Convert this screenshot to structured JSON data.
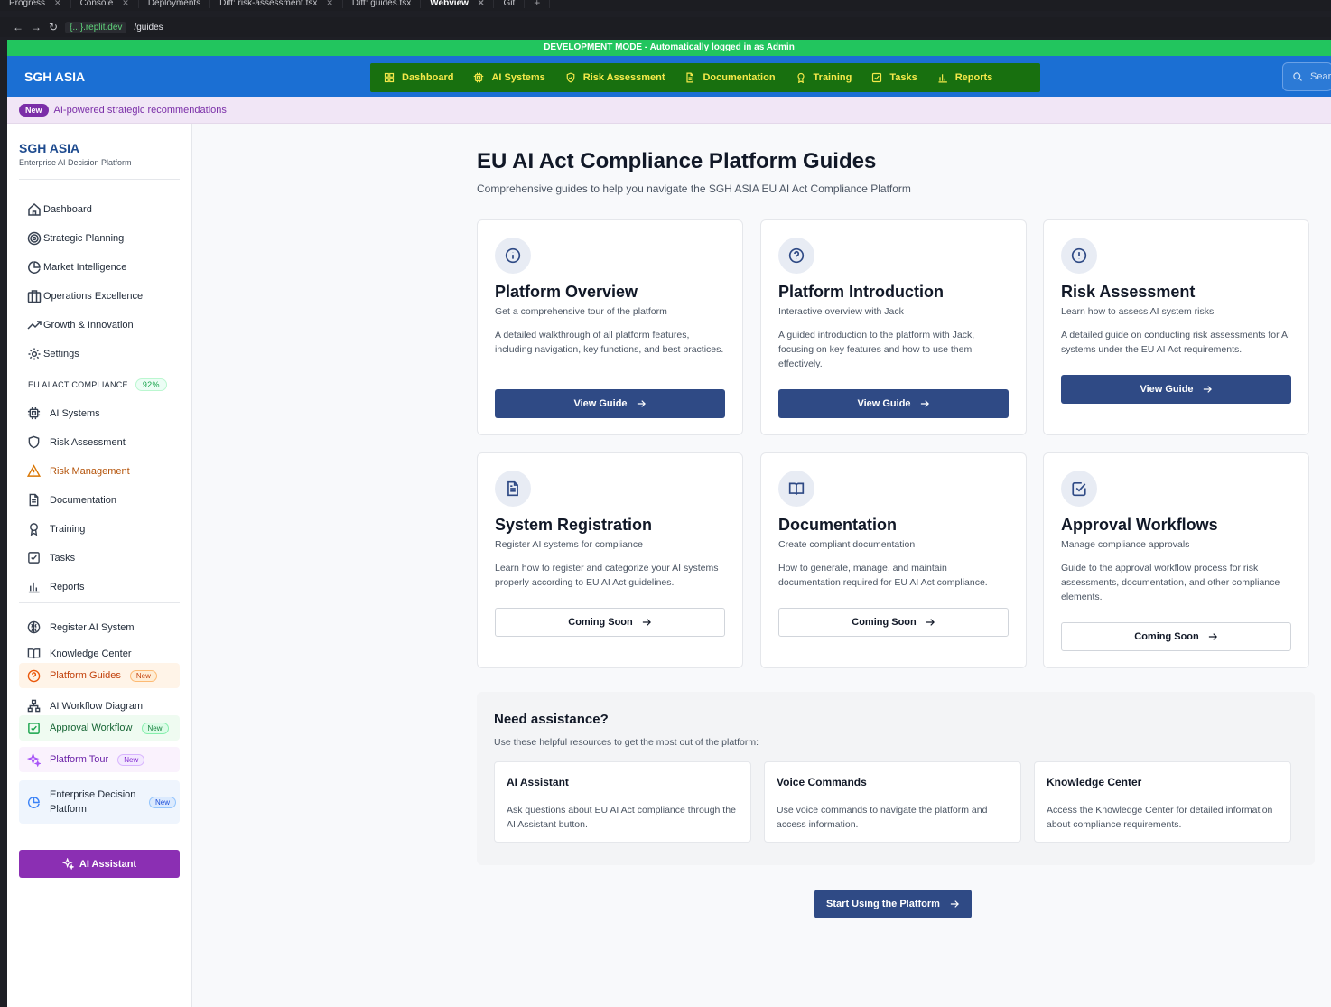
{
  "ide": {
    "tabs": [
      "Progress",
      "Console",
      "Deployments",
      "Diff: risk-assessment.tsx",
      "Diff: guides.tsx",
      "Webview",
      "Git"
    ],
    "host": "{...}.replit.dev",
    "path": "/guides"
  },
  "devbar": "DEVELOPMENT MODE - Automatically logged in as Admin",
  "topbar": {
    "brand": "SGH ASIA",
    "nav": [
      "Dashboard",
      "AI Systems",
      "Risk Assessment",
      "Documentation",
      "Training",
      "Tasks",
      "Reports"
    ],
    "search_placeholder": "Sear"
  },
  "announcement": {
    "badge": "New",
    "text": "AI-powered strategic recommendations"
  },
  "sidebar": {
    "brand": "SGH ASIA",
    "sub": "Enterprise AI Decision Platform",
    "main_items": [
      "Dashboard",
      "Strategic Planning",
      "Market Intelligence",
      "Operations Excellence",
      "Growth & Innovation",
      "Settings"
    ],
    "section_label": "EU AI ACT COMPLIANCE",
    "section_pct": "92%",
    "compliance_items": [
      "AI Systems",
      "Risk Assessment",
      "Risk Management",
      "Documentation",
      "Training",
      "Tasks",
      "Reports"
    ],
    "extra_items": [
      "Register AI System",
      "Knowledge Center"
    ],
    "highlighted": {
      "platform_guides": "Platform Guides",
      "ai_workflow": "AI Workflow Diagram",
      "approval_workflow": "Approval Workflow",
      "platform_tour": "Platform Tour",
      "enterprise_decision": [
        "Enterprise Decision",
        "Platform"
      ]
    },
    "new_label": "New",
    "ai_assistant": "AI Assistant"
  },
  "page": {
    "title": "EU AI Act Compliance Platform Guides",
    "subtitle": "Comprehensive guides to help you navigate the SGH ASIA EU AI Act Compliance Platform"
  },
  "cards": [
    {
      "title": "Platform Overview",
      "sub": "Get a comprehensive tour of the platform",
      "desc": "A detailed walkthrough of all platform features, including navigation, key functions, and best practices.",
      "button": "View Guide"
    },
    {
      "title": "Platform Introduction",
      "sub": "Interactive overview with Jack",
      "desc": "A guided introduction to the platform with Jack, focusing on key features and how to use them effectively.",
      "button": "View Guide"
    },
    {
      "title": "Risk Assessment",
      "sub": "Learn how to assess AI system risks",
      "desc": "A detailed guide on conducting risk assessments for AI systems under the EU AI Act requirements.",
      "button": "View Guide"
    },
    {
      "title": "System Registration",
      "sub": "Register AI systems for compliance",
      "desc": "Learn how to register and categorize your AI systems properly according to EU AI Act guidelines.",
      "button": "Coming Soon"
    },
    {
      "title": "Documentation",
      "sub": "Create compliant documentation",
      "desc": "How to generate, manage, and maintain documentation required for EU AI Act compliance.",
      "button": "Coming Soon"
    },
    {
      "title": "Approval Workflows",
      "sub": "Manage compliance approvals",
      "desc": "Guide to the approval workflow process for risk assessments, documentation, and other compliance elements.",
      "button": "Coming Soon"
    }
  ],
  "assistance": {
    "title": "Need assistance?",
    "subtitle": "Use these helpful resources to get the most out of the platform:",
    "items": [
      {
        "title": "AI Assistant",
        "desc": "Ask questions about EU AI Act compliance through the AI Assistant button."
      },
      {
        "title": "Voice Commands",
        "desc": "Use voice commands to navigate the platform and access information."
      },
      {
        "title": "Knowledge Center",
        "desc": "Access the Knowledge Center for detailed information about compliance requirements."
      }
    ]
  },
  "start_button": "Start Using the Platform",
  "colors": {
    "primary": "#2f4a85",
    "topbar": "#1b6fd3",
    "devbar": "#22c55e",
    "purple": "#8b2fb3"
  }
}
